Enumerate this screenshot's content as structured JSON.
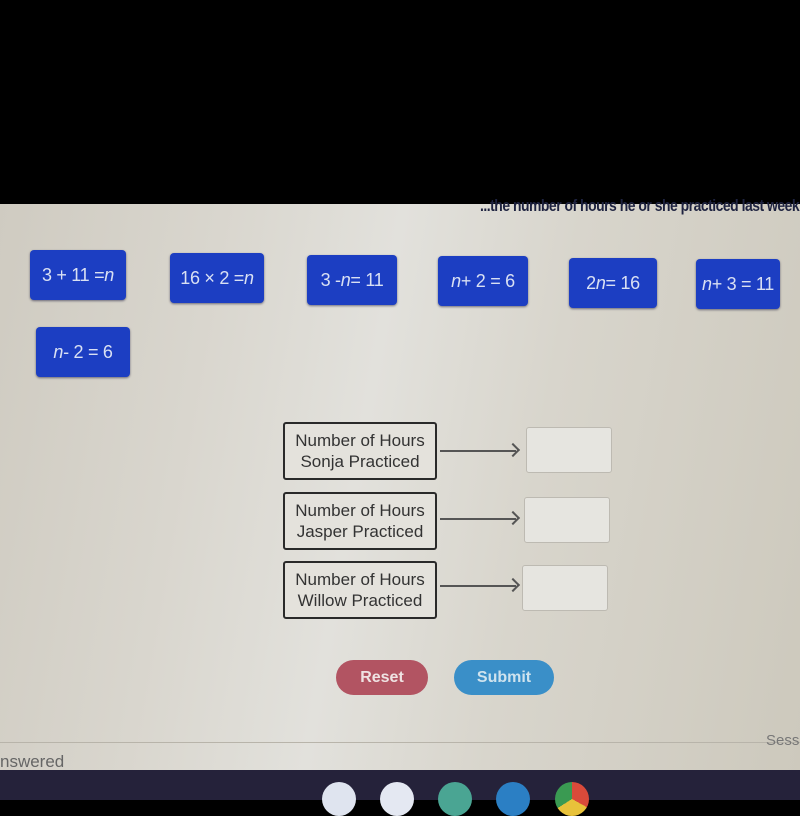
{
  "instruction": {
    "visible_text": "...the number of hours he or she practiced last week."
  },
  "tiles": [
    {
      "pre": "3 + 11 = ",
      "var": "n",
      "post": ""
    },
    {
      "pre": "16 × 2 = ",
      "var": "n",
      "post": ""
    },
    {
      "pre": "3 - ",
      "var": "n",
      "post": " = 11"
    },
    {
      "pre": "",
      "var": "n",
      "post": " + 2 = 6"
    },
    {
      "pre": "2",
      "var": "n",
      "post": " = 16"
    },
    {
      "pre": "",
      "var": "n",
      "post": " + 3 = 11"
    },
    {
      "pre": "",
      "var": "n",
      "post": " - 2 = 6"
    }
  ],
  "rows": [
    {
      "line1": "Number of Hours",
      "line2": "Sonja Practiced",
      "answer": ""
    },
    {
      "line1": "Number of Hours",
      "line2": "Jasper Practiced",
      "answer": ""
    },
    {
      "line1": "Number of Hours",
      "line2": "Willow Practiced",
      "answer": ""
    }
  ],
  "buttons": {
    "reset": "Reset",
    "submit": "Submit"
  },
  "footer": {
    "status": "nswered",
    "session": "Sess"
  },
  "colors": {
    "tile": "#1c3ec2",
    "reset": "#b25462",
    "submit": "#3a8fc8"
  },
  "taskbar": {
    "icons": [
      "camera-app-icon",
      "docs-app-icon",
      "classroom-app-icon",
      "files-app-icon",
      "chrome-icon"
    ]
  }
}
